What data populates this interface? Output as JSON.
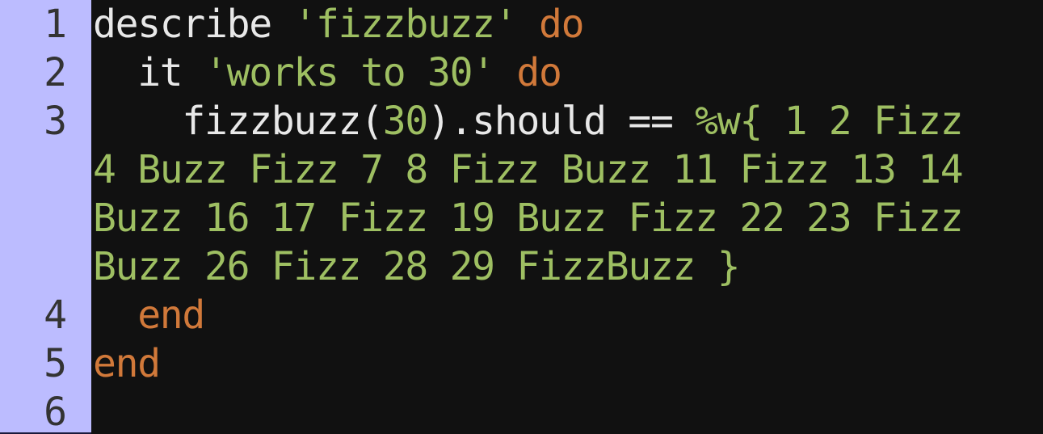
{
  "editor": {
    "line_numbers": [
      "1",
      "2",
      "3",
      "4",
      "5",
      "6"
    ],
    "lines": [
      {
        "tokens": [
          {
            "text": "describe ",
            "type": "plain"
          },
          {
            "text": "'fizzbuzz'",
            "type": "str"
          },
          {
            "text": " ",
            "type": "plain"
          },
          {
            "text": "do",
            "type": "kw"
          }
        ]
      },
      {
        "tokens": [
          {
            "text": "  it ",
            "type": "plain"
          },
          {
            "text": "'works to 30'",
            "type": "str"
          },
          {
            "text": " ",
            "type": "plain"
          },
          {
            "text": "do",
            "type": "kw"
          }
        ]
      },
      {
        "tokens": [
          {
            "text": "    fizzbuzz(",
            "type": "plain"
          },
          {
            "text": "30",
            "type": "num"
          },
          {
            "text": ").should == ",
            "type": "plain"
          },
          {
            "text": "%w{ 1 2 Fizz",
            "type": "str"
          }
        ]
      },
      {
        "tokens": [
          {
            "text": "4 Buzz Fizz 7 8 Fizz Buzz 11 Fizz 13 14",
            "type": "str"
          }
        ]
      },
      {
        "tokens": [
          {
            "text": "Buzz 16 17 Fizz 19 Buzz Fizz 22 23 Fizz",
            "type": "str"
          }
        ]
      },
      {
        "tokens": [
          {
            "text": "Buzz 26 Fizz 28 29 FizzBuzz }",
            "type": "str"
          }
        ]
      },
      {
        "tokens": [
          {
            "text": "  ",
            "type": "plain"
          },
          {
            "text": "end",
            "type": "kw"
          }
        ]
      },
      {
        "tokens": [
          {
            "text": "end",
            "type": "kw"
          }
        ]
      },
      {
        "tokens": []
      }
    ],
    "colors": {
      "background": "#111111",
      "gutter": "#bcbcff",
      "keyword": "#d1793a",
      "string": "#9ebf62",
      "text": "#e8e8e8"
    }
  }
}
